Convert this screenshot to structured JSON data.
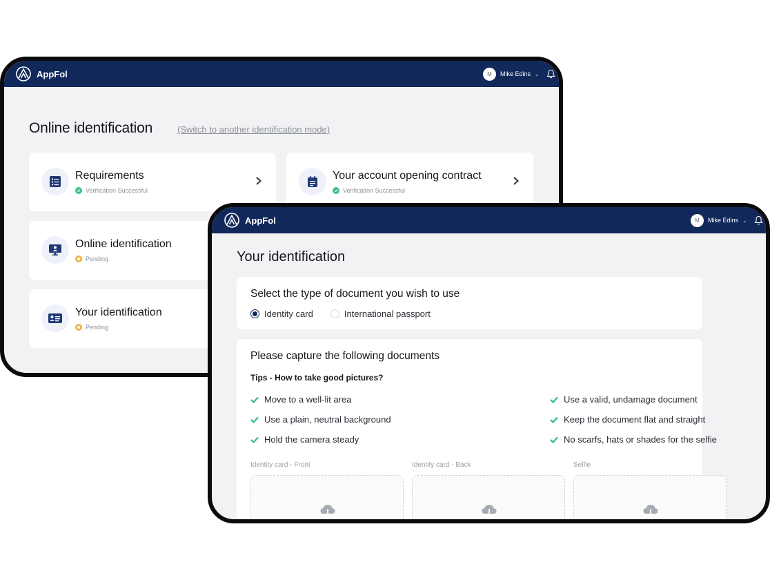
{
  "app": {
    "brand": "AppFol"
  },
  "user": {
    "initial": "M",
    "name": "Mike Edins"
  },
  "colors": {
    "navbar": "#11285a",
    "success": "#3fbf8f",
    "pending": "#f3b447",
    "check": "#3fbf8f"
  },
  "back_screen": {
    "title": "Online identification",
    "switch_link": "(Switch to another identification mode)",
    "cards": [
      {
        "title": "Requirements",
        "status": "Verification Successful",
        "state": "success",
        "icon": "list-icon"
      },
      {
        "title": "Your account opening contract",
        "status": "Verification Successful",
        "state": "success",
        "icon": "calendar-icon"
      },
      {
        "title": "Online identification",
        "status": "Pending",
        "state": "pending",
        "icon": "monitor-user-icon"
      },
      {
        "title": "Your identification",
        "status": "Pending",
        "state": "pending",
        "icon": "id-card-icon"
      }
    ]
  },
  "front_screen": {
    "title": "Your identification",
    "doc_type": {
      "heading": "Select the type of document you wish to use",
      "options": [
        {
          "label": "Identity card",
          "selected": true
        },
        {
          "label": "International passport",
          "selected": false
        }
      ]
    },
    "capture": {
      "heading": "Please capture the following documents",
      "tips_heading": "Tips - How to take good pictures?",
      "tips_left": [
        "Move to a well-lit area",
        "Use a plain, neutral background",
        "Hold the camera steady"
      ],
      "tips_right": [
        "Use a valid, undamage document",
        "Keep the document flat and straight",
        "No scarfs, hats or shades for the selfie"
      ],
      "uploads": [
        "Identity card - Front",
        "Identity card - Back",
        "Selfie"
      ]
    }
  }
}
